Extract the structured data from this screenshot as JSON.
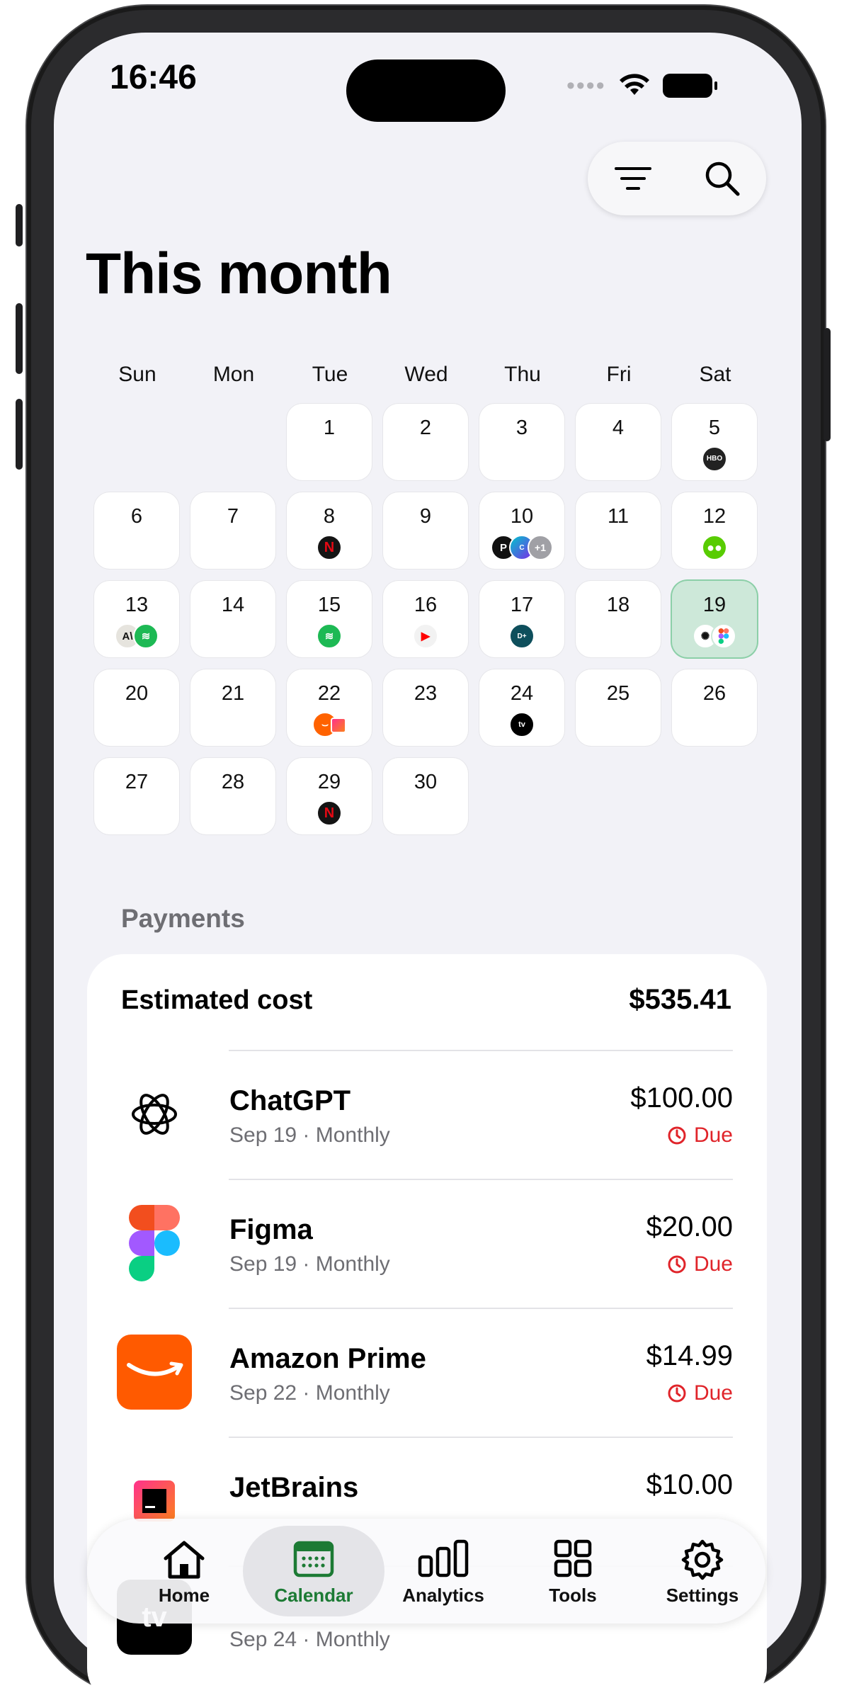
{
  "status": {
    "time": "16:46"
  },
  "page": {
    "title": "This month"
  },
  "weekdays": [
    "Sun",
    "Mon",
    "Tue",
    "Wed",
    "Thu",
    "Fri",
    "Sat"
  ],
  "calendar": {
    "days": [
      "1",
      "2",
      "3",
      "4",
      "5",
      "6",
      "7",
      "8",
      "9",
      "10",
      "11",
      "12",
      "13",
      "14",
      "15",
      "16",
      "17",
      "18",
      "19",
      "20",
      "21",
      "22",
      "23",
      "24",
      "25",
      "26",
      "27",
      "28",
      "29",
      "30"
    ],
    "today": "19",
    "day_icons": {
      "5": [
        "hbo-max-icon"
      ],
      "8": [
        "netflix-icon"
      ],
      "10": [
        "perplexity-icon",
        "canva-icon",
        "+1"
      ],
      "12": [
        "duolingo-icon"
      ],
      "13": [
        "anthropic-icon",
        "spotify-icon"
      ],
      "15": [
        "spotify-icon"
      ],
      "16": [
        "youtube-icon"
      ],
      "17": [
        "disney-plus-icon"
      ],
      "19": [
        "chatgpt-icon",
        "figma-icon"
      ],
      "22": [
        "amazon-icon",
        "jetbrains-icon"
      ],
      "24": [
        "apple-tv-icon"
      ],
      "29": [
        "netflix-icon"
      ]
    },
    "overflow_badge": "+1"
  },
  "payments": {
    "section_title": "Payments",
    "estimated_label": "Estimated cost",
    "estimated_value": "$535.41",
    "items": [
      {
        "name": "ChatGPT",
        "sub": "Sep 19 · Monthly",
        "price": "$100.00",
        "status": "Due",
        "icon": "chatgpt-icon"
      },
      {
        "name": "Figma",
        "sub": "Sep 19 · Monthly",
        "price": "$20.00",
        "status": "Due",
        "icon": "figma-icon"
      },
      {
        "name": "Amazon Prime",
        "sub": "Sep 22 · Monthly",
        "price": "$14.99",
        "status": "Due",
        "icon": "amazon-icon"
      },
      {
        "name": "JetBrains",
        "sub": "",
        "price": "$10.00",
        "status": "",
        "icon": "jetbrains-icon"
      },
      {
        "name": "",
        "sub": "Sep 24 · Monthly",
        "price": "",
        "status": "",
        "icon": "apple-tv-icon"
      }
    ]
  },
  "tabs": [
    {
      "label": "Home",
      "icon": "house-icon"
    },
    {
      "label": "Calendar",
      "icon": "calendar-icon",
      "active": true
    },
    {
      "label": "Analytics",
      "icon": "bar-chart-icon"
    },
    {
      "label": "Tools",
      "icon": "grid-icon"
    },
    {
      "label": "Settings",
      "icon": "gear-icon"
    }
  ],
  "colors": {
    "accent": "#1c7a34",
    "due": "#e0242a",
    "today_bg": "#cde8d9"
  }
}
